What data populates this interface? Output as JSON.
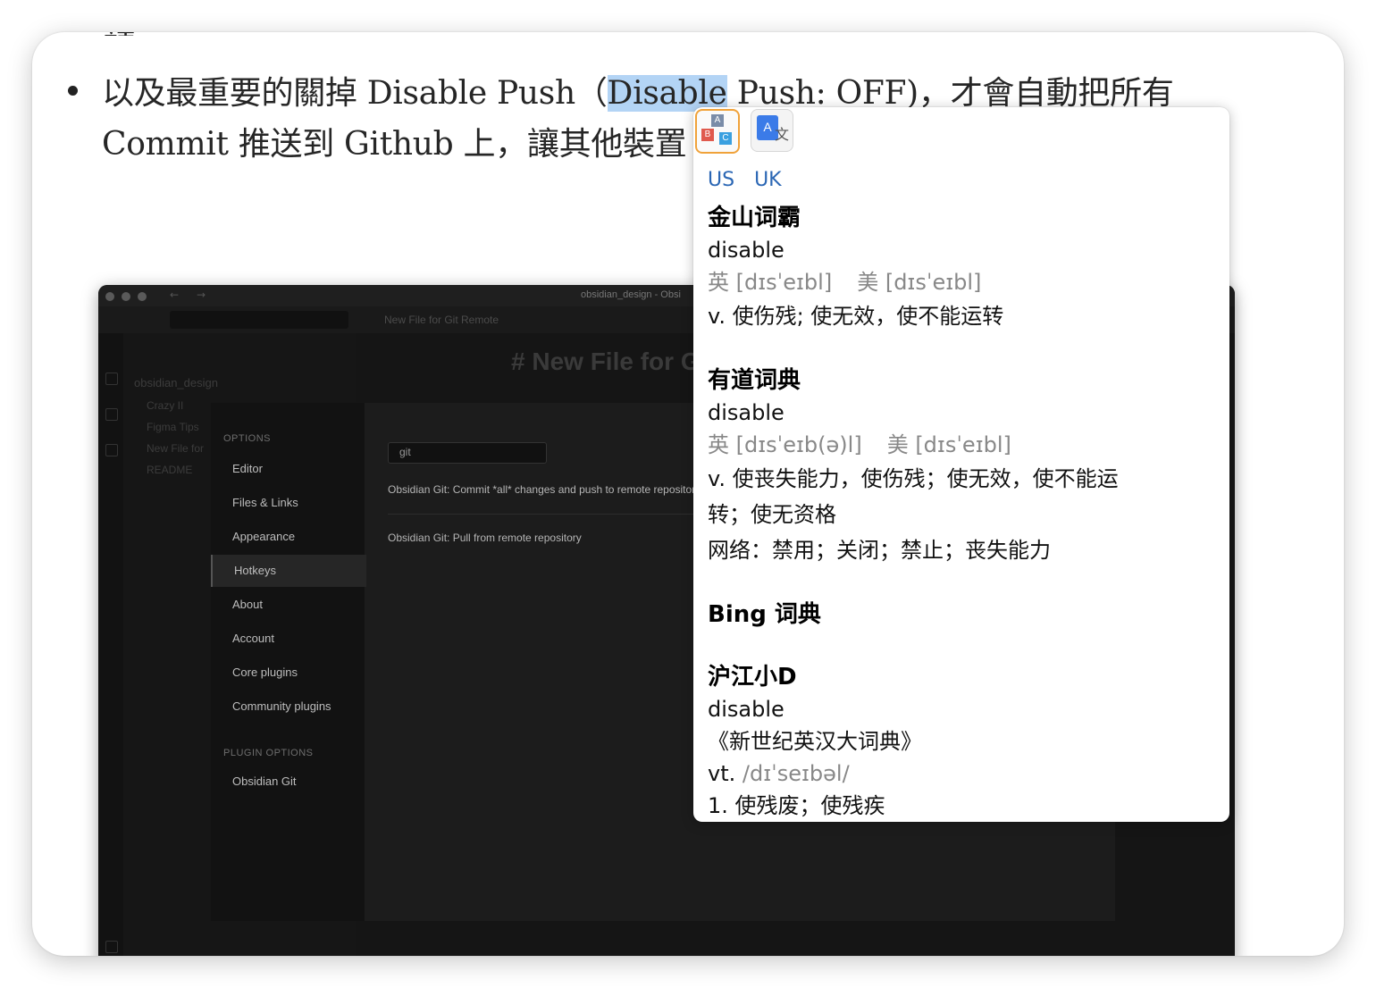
{
  "article": {
    "bullet_line1_before": "以及最重要的關掉 Disable Push（",
    "bullet_highlight": "Disable",
    "bullet_line1_after": " Push: OFF)，才會自動把所有",
    "bullet_line2": "Commit 推送到 Github 上，讓其他裝置"
  },
  "embedded_screenshot": {
    "window_title": "obsidian_design - Obsi",
    "tab_title": "New File for Git Remote",
    "note_heading": "# New File for G",
    "vault_name": "obsidian_design",
    "file_items": [
      "Crazy II",
      "Figma Tips",
      "New File for",
      "README"
    ],
    "settings": {
      "options_header": "OPTIONS",
      "items": [
        "Editor",
        "Files & Links",
        "Appearance",
        "Hotkeys",
        "About",
        "Account",
        "Core plugins",
        "Community plugins"
      ],
      "active_item": "Hotkeys",
      "plugin_options_header": "PLUGIN OPTIONS",
      "plugin_items": [
        "Obsidian Git"
      ]
    },
    "hotkeys": {
      "search_value": "git",
      "rows": [
        "Obsidian Git: Commit *all* changes and push to remote repository",
        "Obsidian Git: Pull from remote repository"
      ]
    }
  },
  "dictionary_popup": {
    "icons": [
      "abc-dictionary-icon",
      "google-translate-icon"
    ],
    "accent_links": [
      "US",
      "UK"
    ],
    "sources": {
      "jinshan": {
        "name": "金山词霸",
        "word": "disable",
        "phonetic_uk": "英 [dɪsˈeɪbl]",
        "phonetic_us": "美 [dɪsˈeɪbl]",
        "definition": "v. 使伤残; 使无效，使不能运转"
      },
      "youdao": {
        "name": "有道词典",
        "word": "disable",
        "phonetic_uk": "英 [dɪsˈeɪb(ə)l]",
        "phonetic_us": "美 [dɪsˈeɪbl]",
        "definition_line1": "v. 使丧失能力，使伤残；使无效，使不能运",
        "definition_line2": "转；使无资格",
        "web": "网络：禁用；关闭；禁止；丧失能力"
      },
      "bing": {
        "name": "Bing 词典"
      },
      "hujiang": {
        "name": "沪江小D",
        "word": "disable",
        "dictionary": "《新世纪英汉大词典》",
        "pos": "vt.",
        "phonetic": "/dɪˈseɪbəl/",
        "sense1": "1. 使残废；使残疾"
      }
    }
  }
}
